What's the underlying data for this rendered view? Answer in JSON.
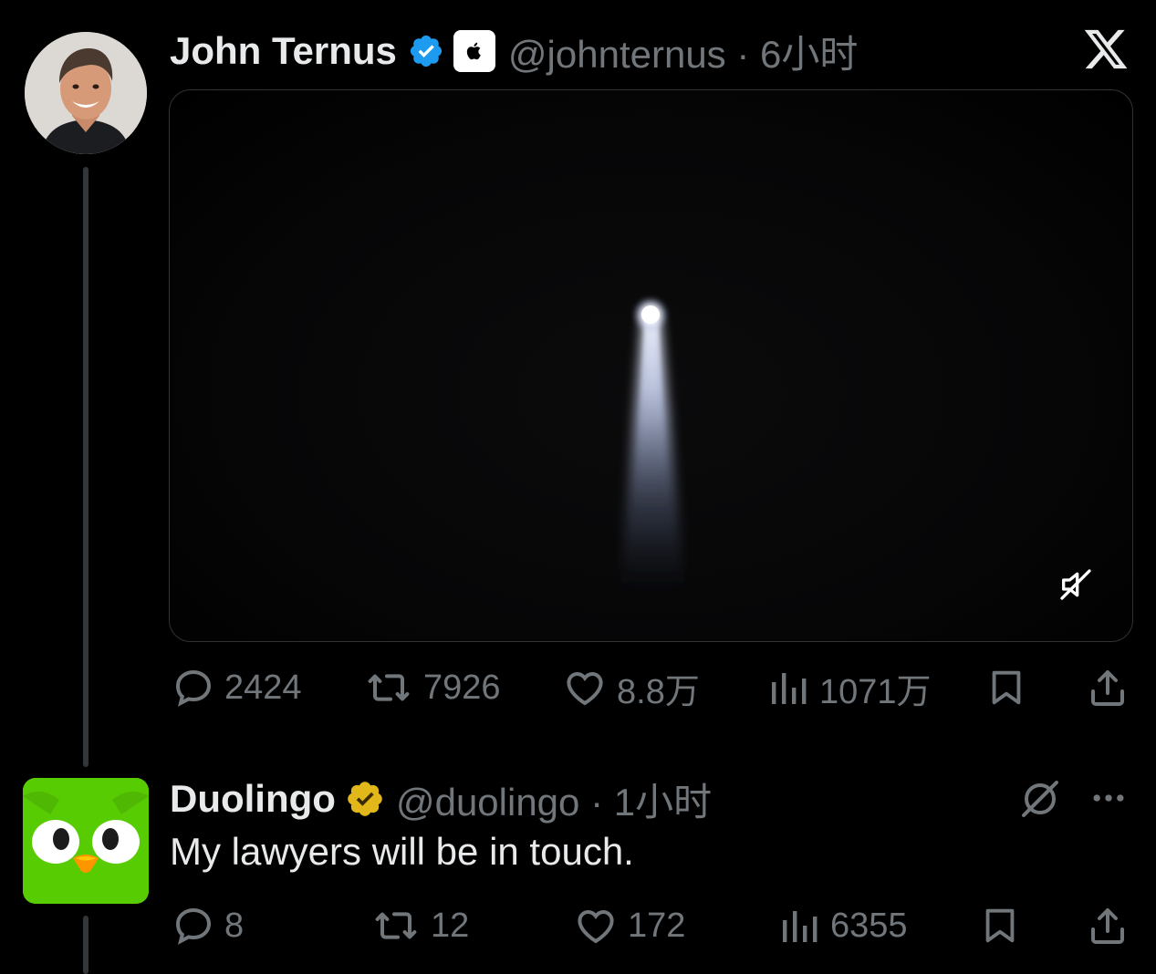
{
  "tweet": {
    "author_name": "John Ternus",
    "handle_time": "@johnternus · 6小时",
    "affiliate_icon": "apple-logo-icon",
    "avatar_icon": "profile-photo",
    "media": {
      "kind": "video",
      "description_icon": "spotlight-beam",
      "muted_icon": "muted-speaker-icon"
    },
    "stats": {
      "replies": "2424",
      "reposts": "7926",
      "likes": "8.8万",
      "views": "1071万"
    }
  },
  "reply": {
    "author_name": "Duolingo",
    "handle_time": "@duolingo · 1小时",
    "text": "My lawyers will be in touch.",
    "stats": {
      "replies": "8",
      "reposts": "12",
      "likes": "172",
      "views": "6355"
    }
  },
  "colors": {
    "background": "#000000",
    "text": "#e7e9ea",
    "muted": "#71767b",
    "verified_blue": "#1d9bf0",
    "verified_gold": "#e2b719",
    "duolingo_green": "#58cc02"
  }
}
